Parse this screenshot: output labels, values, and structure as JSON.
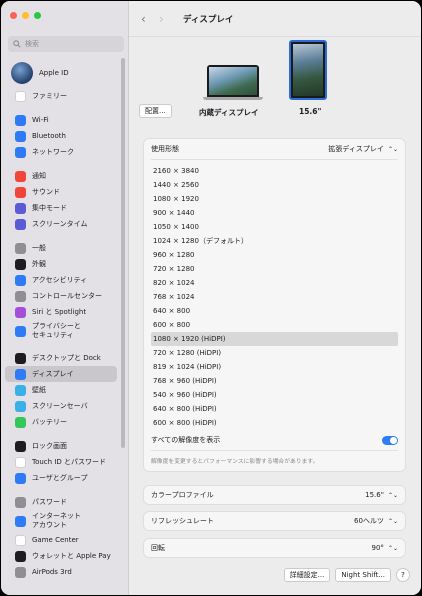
{
  "window": {
    "title": "ディスプレイ"
  },
  "search": {
    "placeholder": "検索"
  },
  "sidebar": {
    "apple_id": "Apple ID",
    "items": [
      {
        "label": "ファミリー",
        "icon": "family-icon",
        "color": "#ffffff"
      },
      {
        "label": "Wi-Fi",
        "icon": "wifi-icon",
        "color": "#2d7cf6"
      },
      {
        "label": "Bluetooth",
        "icon": "bluetooth-icon",
        "color": "#2d7cf6"
      },
      {
        "label": "ネットワーク",
        "icon": "globe-icon",
        "color": "#2d7cf6"
      },
      {
        "label": "通知",
        "icon": "bell-icon",
        "color": "#f0453a"
      },
      {
        "label": "サウンド",
        "icon": "speaker-icon",
        "color": "#f0453a"
      },
      {
        "label": "集中モード",
        "icon": "moon-icon",
        "color": "#5b5bd6"
      },
      {
        "label": "スクリーンタイム",
        "icon": "hourglass-icon",
        "color": "#5b5bd6"
      },
      {
        "label": "一般",
        "icon": "gear-icon",
        "color": "#8e8e93"
      },
      {
        "label": "外観",
        "icon": "appearance-icon",
        "color": "#1d1d1f"
      },
      {
        "label": "アクセシビリティ",
        "icon": "accessibility-icon",
        "color": "#2d7cf6"
      },
      {
        "label": "コントロールセンター",
        "icon": "control-center-icon",
        "color": "#8e8e93"
      },
      {
        "label": "Siri と Spotlight",
        "icon": "siri-icon",
        "color": "#a44fd8"
      },
      {
        "label": "プライバシーと\nセキュリティ",
        "icon": "hand-icon",
        "color": "#2d7cf6"
      },
      {
        "label": "デスクトップと Dock",
        "icon": "dock-icon",
        "color": "#1d1d1f"
      },
      {
        "label": "ディスプレイ",
        "icon": "display-icon",
        "color": "#2d7cf6"
      },
      {
        "label": "壁紙",
        "icon": "wallpaper-icon",
        "color": "#3ab0e8"
      },
      {
        "label": "スクリーンセーバ",
        "icon": "screensaver-icon",
        "color": "#3ab0e8"
      },
      {
        "label": "バッテリー",
        "icon": "battery-icon",
        "color": "#34c759"
      },
      {
        "label": "ロック画面",
        "icon": "lock-icon",
        "color": "#1d1d1f"
      },
      {
        "label": "Touch ID とパスワード",
        "icon": "fingerprint-icon",
        "color": "#ffffff"
      },
      {
        "label": "ユーザとグループ",
        "icon": "users-icon",
        "color": "#2d7cf6"
      },
      {
        "label": "パスワード",
        "icon": "key-icon",
        "color": "#8e8e93"
      },
      {
        "label": "インターネット\nアカウント",
        "icon": "at-icon",
        "color": "#2d7cf6"
      },
      {
        "label": "Game Center",
        "icon": "gamecenter-icon",
        "color": "#ffffff"
      },
      {
        "label": "ウォレットと Apple Pay",
        "icon": "wallet-icon",
        "color": "#1d1d1f"
      },
      {
        "label": "AirPods 3rd",
        "icon": "airpods-icon",
        "color": "#8e8e93"
      }
    ]
  },
  "displays": {
    "arrange_label": "配置...",
    "builtin_label": "内蔵ディスプレイ",
    "external_label": "15.6\""
  },
  "settings": {
    "use_as_label": "使用形態",
    "use_as_value": "拡張ディスプレイ",
    "resolutions": [
      "2160 × 3840",
      "1440 × 2560",
      "1080 × 1920",
      "900 × 1440",
      "1050 × 1400",
      "1024 × 1280（デフォルト）",
      "960 × 1280",
      "720 × 1280",
      "820 × 1024",
      "768 × 1024",
      "640 × 800",
      "600 × 800",
      "1080 × 1920 (HiDPI)",
      "720 × 1280 (HiDPI)",
      "819 × 1024 (HiDPI)",
      "768 × 960 (HiDPI)",
      "540 × 960 (HiDPI)",
      "640 × 800 (HiDPI)",
      "600 × 800 (HiDPI)"
    ],
    "selected_index": 12,
    "show_all_label": "すべての解像度を表示",
    "show_all_on": true,
    "note": "解像度を変更するとパフォーマンスに影響する場合があります。",
    "color_profile_label": "カラープロファイル",
    "color_profile_value": "15.6\"",
    "refresh_label": "リフレッシュレート",
    "refresh_value": "60ヘルツ",
    "rotation_label": "回転",
    "rotation_value": "90°",
    "advanced_label": "詳細設定...",
    "nightshift_label": "Night Shift...",
    "help_label": "?"
  }
}
